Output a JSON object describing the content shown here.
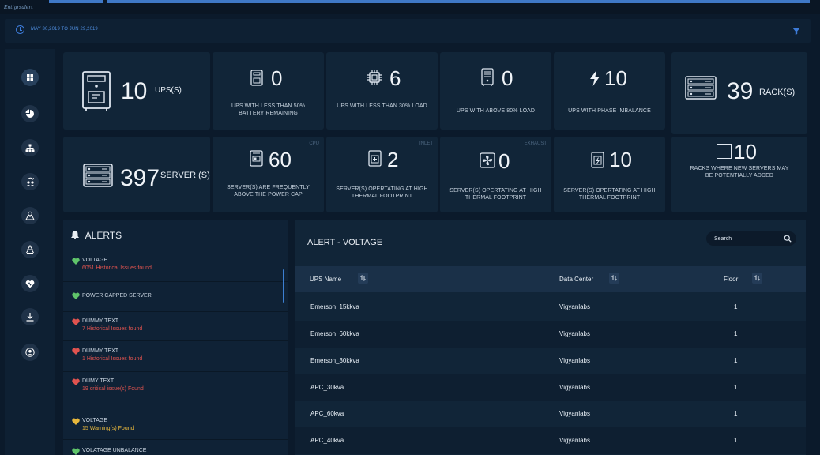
{
  "app": {
    "logo_text": "Entigrsalert"
  },
  "date_range": "MAY 30,2019 TO JUN 29,2019",
  "sidebar": {
    "items": [
      {
        "name": "dashboard",
        "icon": "grid-icon"
      },
      {
        "name": "analytics",
        "icon": "pie-chart-icon"
      },
      {
        "name": "hierarchy",
        "icon": "org-chart-icon"
      },
      {
        "name": "sync",
        "icon": "people-sync-icon"
      },
      {
        "name": "map",
        "icon": "map-icon"
      },
      {
        "name": "recycle",
        "icon": "recycle-icon"
      },
      {
        "name": "health",
        "icon": "heart-pulse-icon"
      },
      {
        "name": "download",
        "icon": "download-icon"
      },
      {
        "name": "user",
        "icon": "user-icon"
      }
    ]
  },
  "summary": {
    "ups": {
      "value": "10",
      "label": "UPS(S)"
    },
    "ups_battery": {
      "value": "0",
      "label": "UPS WITH LESS THAN 50% BATTERY REMAINING"
    },
    "ups_low_load": {
      "value": "6",
      "label": "UPS WITH LESS THAN 30% LOAD"
    },
    "ups_high_load": {
      "value": "0",
      "label": "UPS WITH ABOVE 80% LOAD"
    },
    "ups_phase": {
      "value": "10",
      "label": "UPS WITH PHASE IMBALANCE"
    },
    "racks": {
      "value": "39",
      "label": "RACK(S)"
    },
    "servers": {
      "value": "397",
      "label": "SERVER (S)"
    },
    "power_cap": {
      "tag": "CPU",
      "value": "60",
      "label": "SERVER(S) ARE FREQUENTLY ABOVE THE POWER CAP"
    },
    "inlet": {
      "tag": "INLET",
      "value": "2",
      "label": "SERVER(S) OPERTATING AT HIGH THERMAL FOOTPRINT"
    },
    "exhaust": {
      "tag": "EXHAUST",
      "value": "0",
      "label": "SERVER(S) OPERTATING AT HIGH THERMAL FOOTPRINT"
    },
    "thermal4": {
      "value": "10",
      "label": "SERVER(S) OPERTATING AT HIGH THERMAL FOOTPRINT"
    },
    "racks_new": {
      "value": "10",
      "label": "RACKS WHERE NEW SERVERS MAY BE POTENTIALLY ADDED"
    }
  },
  "alerts": {
    "title": "ALERTS",
    "items": [
      {
        "title": "VOLTAGE",
        "sub": "6051 Historical Issues found",
        "color": "#5fc46a",
        "sub_color": "#e0534f"
      },
      {
        "title": "POWER CAPPED SERVER",
        "sub": "",
        "color": "#5fc46a",
        "sub_color": "#e0534f"
      },
      {
        "title": "DUMMY TEXT",
        "sub": "7 Historical Issues found",
        "color": "#e0534f",
        "sub_color": "#e0534f"
      },
      {
        "title": "DUMMY TEXT",
        "sub": "1 Historical Issues found",
        "color": "#e0534f",
        "sub_color": "#e0534f"
      },
      {
        "title": "DUMY TEXT",
        "sub": "19 critical issue(s) Found",
        "color": "#e0534f",
        "sub_color": "#e0534f"
      },
      {
        "title": "VOLTAGE",
        "sub": "15 Warning(s) Found",
        "color": "#e7b73c",
        "sub_color": "#e7b73c"
      },
      {
        "title": "VOLATAGE UNBALANCE",
        "sub": "",
        "color": "#5fc46a",
        "sub_color": "#e0534f"
      }
    ]
  },
  "table": {
    "title": "ALERT - VOLTAGE",
    "search_placeholder": "Search",
    "columns": [
      "UPS Name",
      "Data Center",
      "Floor"
    ],
    "rows": [
      [
        "Emerson_15kkva",
        "Vigyanlabs",
        "1"
      ],
      [
        "Emerson_60kkva",
        "Vigyanlabs",
        "1"
      ],
      [
        "Emerson_30kkva",
        "Vigyanlabs",
        "1"
      ],
      [
        "APC_30kva",
        "Vigyanlabs",
        "1"
      ],
      [
        "APC_60kva",
        "Vigyanlabs",
        "1"
      ],
      [
        "APC_40kva",
        "Vigyanlabs",
        "1"
      ]
    ]
  },
  "colors": {
    "accent": "#3d7bd8",
    "ok": "#5fc46a",
    "critical": "#e0534f",
    "warning": "#e7b73c"
  }
}
